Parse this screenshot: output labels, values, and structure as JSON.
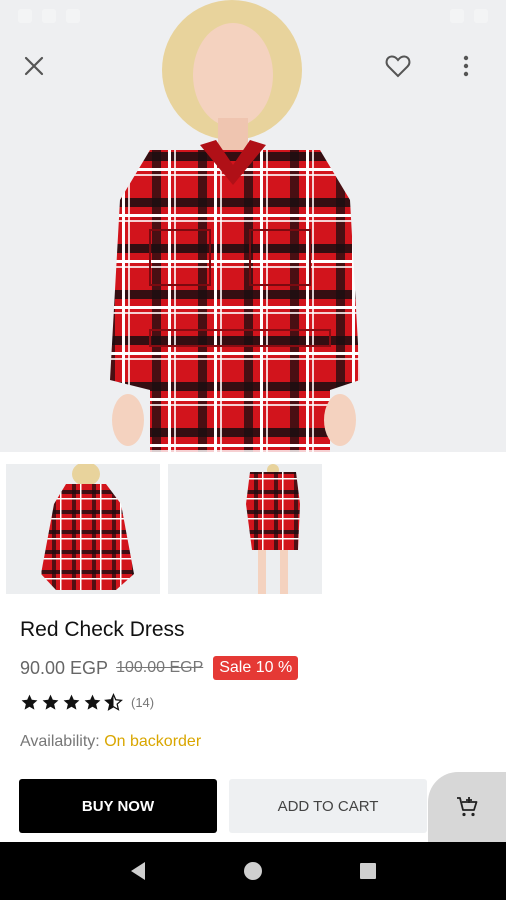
{
  "product": {
    "title": "Red Check Dress",
    "price": "90.00 EGP",
    "old_price": "100.00 EGP",
    "sale_badge": "Sale 10 %",
    "rating": 4.5,
    "rating_count": "(14)",
    "availability_label": "Availability:",
    "availability_value": "On backorder"
  },
  "actions": {
    "buy_now": "BUY NOW",
    "add_to_cart": "ADD TO CART"
  },
  "icons": {
    "close": "close-icon",
    "favorite": "heart-outline-icon",
    "more": "more-vertical-icon",
    "cart_add": "cart-add-icon",
    "nav_back": "back-triangle-icon",
    "nav_home": "home-circle-icon",
    "nav_recents": "recents-square-icon"
  },
  "colors": {
    "accent_sale": "#e53935",
    "availability": "#d9a600",
    "buy_button": "#000000",
    "cart_button": "#eef0f2"
  }
}
